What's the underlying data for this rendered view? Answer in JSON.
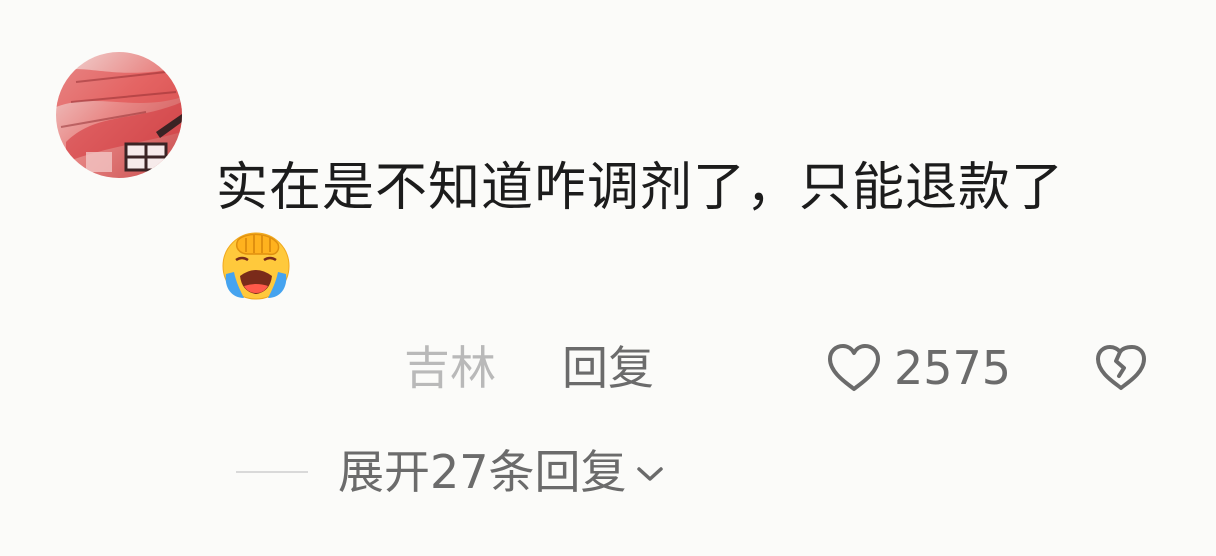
{
  "comment": {
    "text": "实在是不知道咋调剂了，只能退款了",
    "emoji": "face-palm-crying-emoji",
    "location": "吉林",
    "reply_label": "回复",
    "like_count": "2575"
  },
  "replies": {
    "expand_label": "展开27条回复"
  },
  "icons": {
    "like": "heart-outline-icon",
    "dislike": "broken-heart-icon",
    "expand": "chevron-down-icon"
  },
  "colors": {
    "background": "#fbfbf9",
    "primary_text": "#1c1c1c",
    "secondary_text": "#6b6b6b",
    "muted_text": "#b9b9b9"
  }
}
